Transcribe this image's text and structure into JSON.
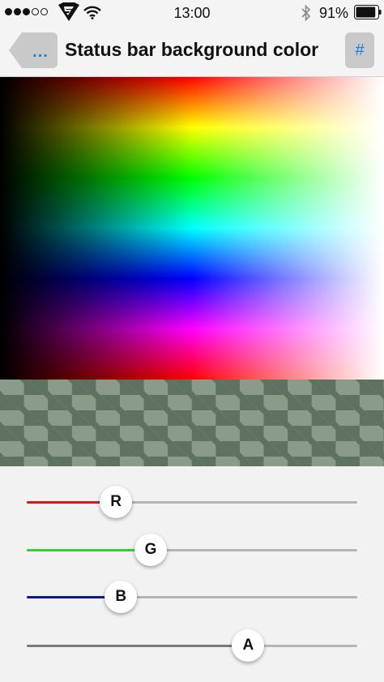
{
  "status_bar": {
    "signal_strength": 3,
    "signal_max": 5,
    "carrier_icon": "superman-logo-icon",
    "wifi_icon": "wifi-icon",
    "time": "13:00",
    "bluetooth_icon": "bluetooth-icon",
    "battery_percent": "91%",
    "battery_level": 0.91
  },
  "nav": {
    "back_label": "...",
    "title": "Status bar background color",
    "hex_label": "#"
  },
  "preview": {
    "checker_light": "#8a9b8a",
    "checker_dark": "#5e725f"
  },
  "sliders": [
    {
      "key": "r",
      "label": "R",
      "color": "#d11a1a",
      "value": 0.27
    },
    {
      "key": "g",
      "label": "G",
      "color": "#2fd12f",
      "value": 0.375
    },
    {
      "key": "b",
      "label": "B",
      "color": "#0c1a8c",
      "value": 0.285
    },
    {
      "key": "a",
      "label": "A",
      "color": "#7a7a7a",
      "value": 0.67
    }
  ]
}
